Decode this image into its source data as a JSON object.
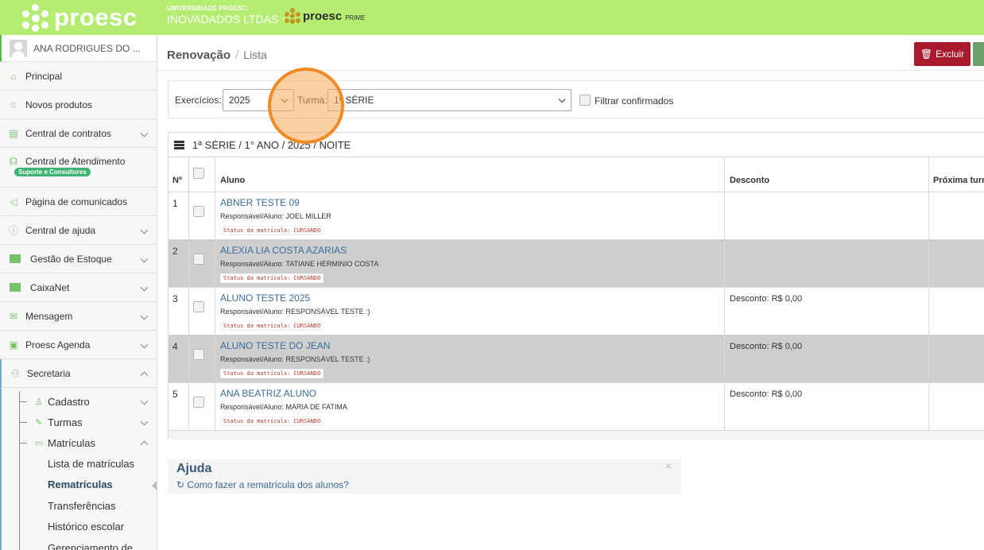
{
  "header": {
    "logo_text": "proesc",
    "org_label": "UNIVERSIDADE PROESC:",
    "org_name": "INOVADADOS LTDAS",
    "prime_text": "proesc",
    "prime_sub": "PRIME",
    "bg_color": "#b5ec72"
  },
  "sidebar": {
    "user_name": "ANA RODRIGUES DO ...",
    "items": [
      {
        "label": "Principal",
        "icon": "home-icon"
      },
      {
        "label": "Novos produtos",
        "icon": "star-icon"
      },
      {
        "label": "Central de contratos",
        "icon": "document-icon"
      },
      {
        "label": "Central de Atendimento",
        "icon": "headset-icon",
        "badge": "Suporte e Consultores"
      },
      {
        "label": "Página de comunicados",
        "icon": "megaphone-icon"
      },
      {
        "label": "Central de ajuda",
        "icon": "info-icon"
      },
      {
        "label": "Gestão de Estoque",
        "icon": "box-icon"
      },
      {
        "label": "CaixaNet",
        "icon": "box-icon"
      },
      {
        "label": "Mensagem",
        "icon": "envelope-icon"
      },
      {
        "label": "Proesc Agenda",
        "icon": "agenda-icon"
      },
      {
        "label": "Secretaria",
        "icon": "users-icon"
      }
    ],
    "secretaria_sub": [
      {
        "label": "Cadastro",
        "icon": "user-icon"
      },
      {
        "label": "Turmas",
        "icon": "pencil-icon"
      },
      {
        "label": "Matrículas",
        "icon": "id-card-icon"
      }
    ],
    "matriculas_items": [
      "Lista de matrículas",
      "Rematrículas",
      "Transferências",
      "Histórico escolar",
      "Gerenciamento de"
    ]
  },
  "main": {
    "breadcrumb": {
      "section": "Renovação",
      "separator": "/",
      "current": "Lista"
    },
    "excluir_label": "Excluir",
    "excluir_color": "#a8192e",
    "filters": {
      "exercicios_label": "Exercícios:",
      "exercicios_value": "2025",
      "turma_label": "Turma:",
      "turma_value": "1ª SÉRIE",
      "confirmados_label": "Filtrar confirmados"
    },
    "panel_title": "1ª SÉRIE / 1° ANO / 2025 / NOITE",
    "columns": {
      "num": "Nº",
      "aluno": "Aluno",
      "desconto": "Desconto",
      "proxima": "Próxima turm"
    },
    "rows": [
      {
        "num": "1",
        "aluno": "ABNER TESTE 09",
        "responsavel": "Responsável/Aluno: JOEL MILLER",
        "status": "Status da matrícula: CURSANDO",
        "desconto": ""
      },
      {
        "num": "2",
        "aluno": "ALEXIA LIA COSTA AZARIAS",
        "responsavel": "Responsável/Aluno: TATIANE HERMINIO COSTA",
        "status": "Status da matrícula: CURSANDO",
        "desconto": ""
      },
      {
        "num": "3",
        "aluno": "ALUNO TESTE 2025",
        "responsavel": "Responsável/Aluno: RESPONSÁVEL TESTE :)",
        "status": "Status da matrícula: CURSANDO",
        "desconto": "Desconto: R$ 0,00"
      },
      {
        "num": "4",
        "aluno": "ALUNO TESTE DO JEAN",
        "responsavel": "Responsável/Aluno: RESPONSÁVEL TESTE :)",
        "status": "Status da matrícula: CURSANDO",
        "desconto": "Desconto: R$ 0,00"
      },
      {
        "num": "5",
        "aluno": "ANA BEATRIZ ALUNO",
        "responsavel": "Responsável/Aluno: MARIA DE FATIMA",
        "status": "Status da matrícula: CURSANDO",
        "desconto": "Desconto: R$ 0,00"
      }
    ],
    "ajuda": {
      "title": "Ajuda",
      "link": "Como fazer a rematrícula dos alunos?",
      "close": "×"
    }
  }
}
